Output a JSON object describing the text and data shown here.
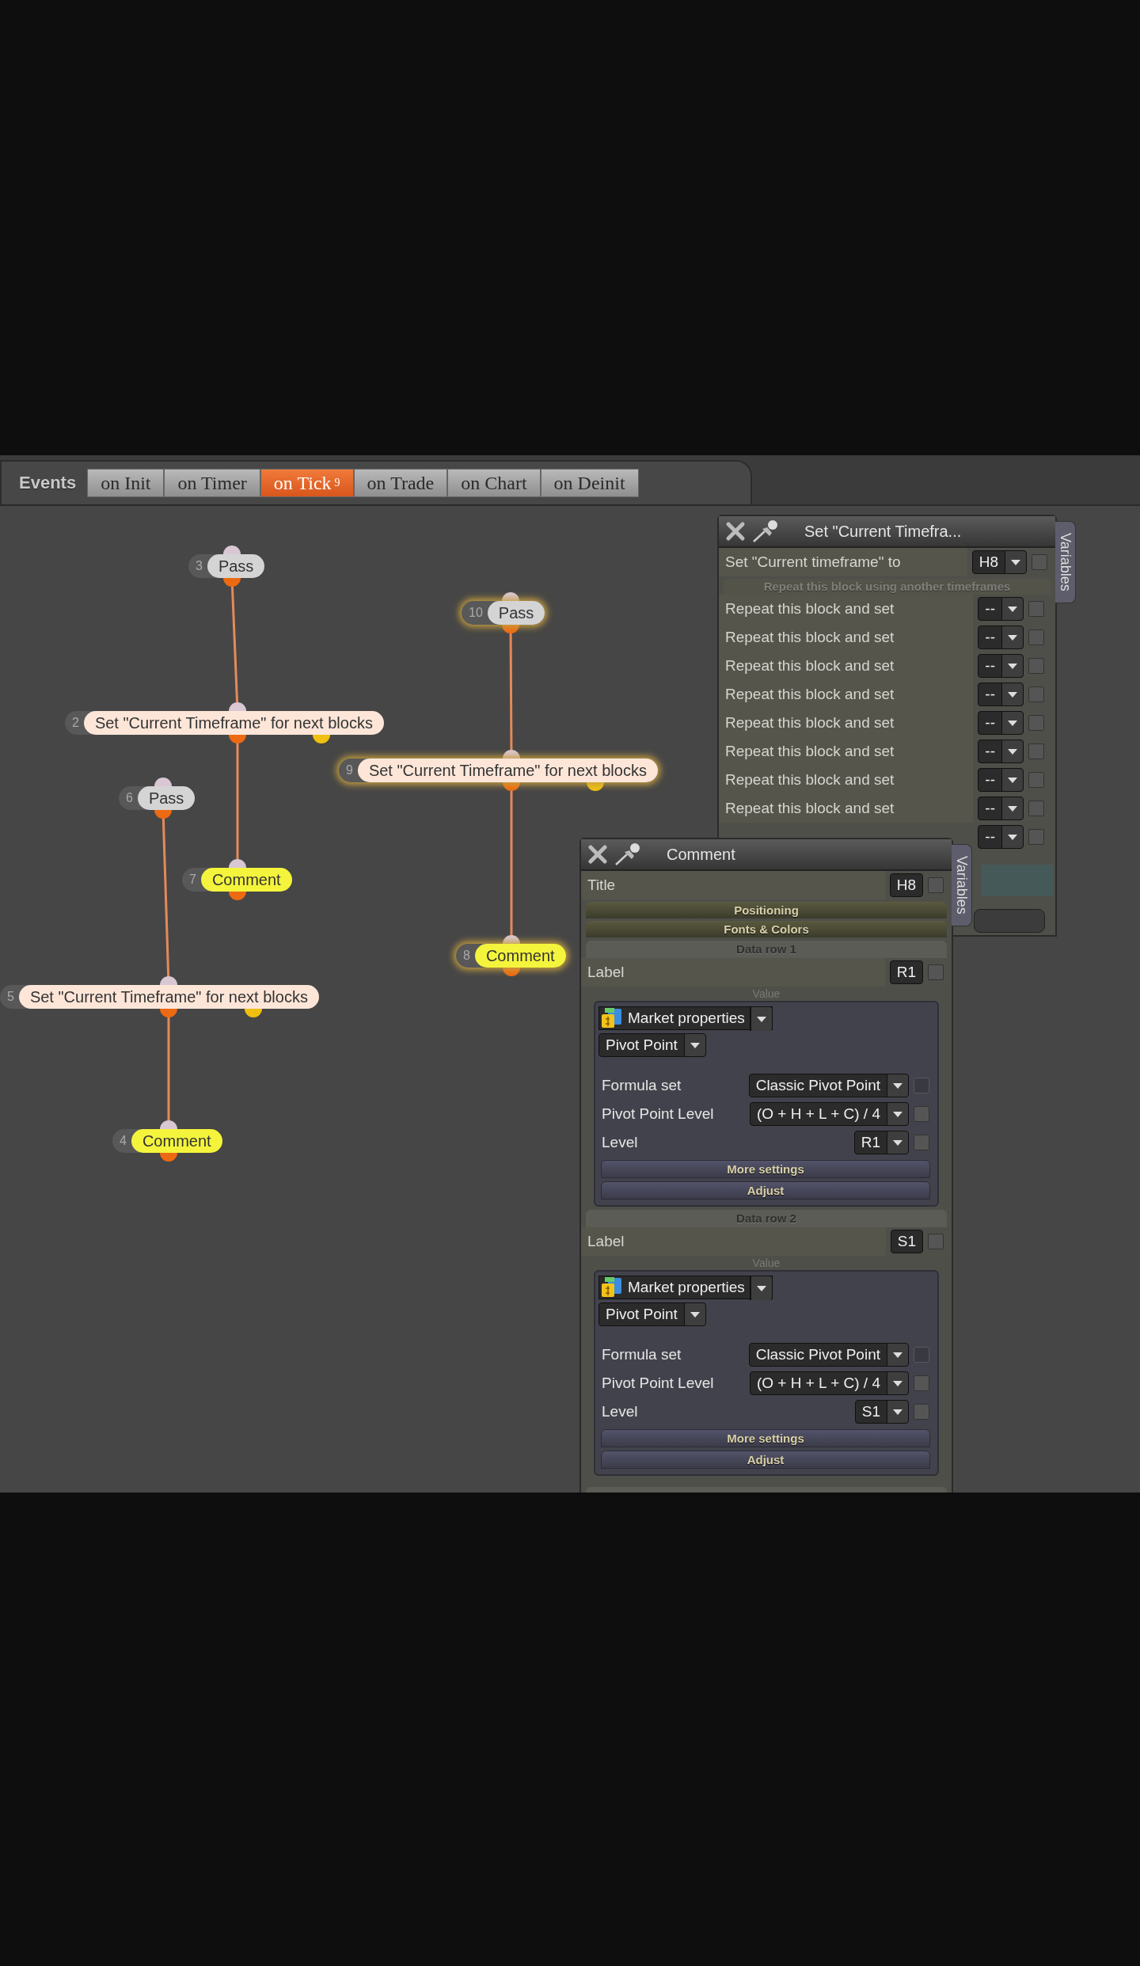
{
  "tabs_bar": {
    "label": "Events",
    "tabs": [
      {
        "label": "on Init",
        "selected": false
      },
      {
        "label": "on Timer",
        "selected": false
      },
      {
        "label": "on Tick",
        "selected": true,
        "badge": "9"
      },
      {
        "label": "on Trade",
        "selected": false
      },
      {
        "label": "on Chart",
        "selected": false
      },
      {
        "label": "on Deinit",
        "selected": false
      }
    ]
  },
  "nodes": [
    {
      "number": "3",
      "label": "Pass",
      "kind": "pass",
      "selected": false
    },
    {
      "number": "10",
      "label": "Pass",
      "kind": "pass",
      "selected": true
    },
    {
      "number": "2",
      "label": "Set \"Current Timeframe\" for next blocks",
      "kind": "set",
      "selected": false
    },
    {
      "number": "9",
      "label": "Set \"Current Timeframe\" for next blocks",
      "kind": "set",
      "selected": true
    },
    {
      "number": "6",
      "label": "Pass",
      "kind": "pass",
      "selected": false
    },
    {
      "number": "7",
      "label": "Comment",
      "kind": "comment",
      "selected": false
    },
    {
      "number": "8",
      "label": "Comment",
      "kind": "comment",
      "selected": true
    },
    {
      "number": "5",
      "label": "Set \"Current Timeframe\" for next blocks",
      "kind": "set",
      "selected": false
    },
    {
      "number": "4",
      "label": "Comment",
      "kind": "comment",
      "selected": false
    }
  ],
  "set_timeframe_panel": {
    "title": "Set \"Current Timefra...",
    "variables_tab": "Variables",
    "timeframe_row": {
      "label": "Set \"Current timeframe\" to",
      "value": "H8",
      "checked": false
    },
    "section": "Repeat this block using another timeframes",
    "repeat_rows": [
      {
        "label": "Repeat this block and set",
        "value": "--",
        "checked": false
      },
      {
        "label": "Repeat this block and set",
        "value": "--",
        "checked": false
      },
      {
        "label": "Repeat this block and set",
        "value": "--",
        "checked": false
      },
      {
        "label": "Repeat this block and set",
        "value": "--",
        "checked": false
      },
      {
        "label": "Repeat this block and set",
        "value": "--",
        "checked": false
      },
      {
        "label": "Repeat this block and set",
        "value": "--",
        "checked": false
      },
      {
        "label": "Repeat this block and set",
        "value": "--",
        "checked": false
      },
      {
        "label": "Repeat this block and set",
        "value": "--",
        "checked": false
      },
      {
        "value": "--",
        "checked": false
      }
    ]
  },
  "comment_panel": {
    "title": "Comment",
    "variables_tab": "Variables",
    "title_row": {
      "label": "Title",
      "value": "H8",
      "checked": false
    },
    "sections": [
      "Positioning",
      "Fonts & Colors"
    ],
    "data_rows": [
      {
        "header": "Data row 1",
        "label": "Label",
        "label_value": "R1",
        "label_checked": false,
        "value_caption": "Value",
        "source": "Market properties",
        "property": "Pivot Point",
        "params": [
          {
            "label": "Formula set",
            "value": "Classic Pivot Point",
            "checked": false,
            "disabled": true
          },
          {
            "label": "Pivot Point Level",
            "value": "(O + H + L + C) / 4",
            "checked": false,
            "disabled": false
          },
          {
            "label": "Level",
            "value": "R1",
            "checked": false,
            "disabled": false
          }
        ],
        "buttons": [
          "More settings",
          "Adjust"
        ]
      },
      {
        "header": "Data row 2",
        "label": "Label",
        "label_value": "S1",
        "label_checked": false,
        "value_caption": "Value",
        "source": "Market properties",
        "property": "Pivot Point",
        "params": [
          {
            "label": "Formula set",
            "value": "Classic Pivot Point",
            "checked": false,
            "disabled": true
          },
          {
            "label": "Pivot Point Level",
            "value": "(O + H + L + C) / 4",
            "checked": false,
            "disabled": false
          },
          {
            "label": "Level",
            "value": "S1",
            "checked": false,
            "disabled": false
          }
        ],
        "buttons": [
          "More settings",
          "Adjust"
        ]
      }
    ]
  }
}
